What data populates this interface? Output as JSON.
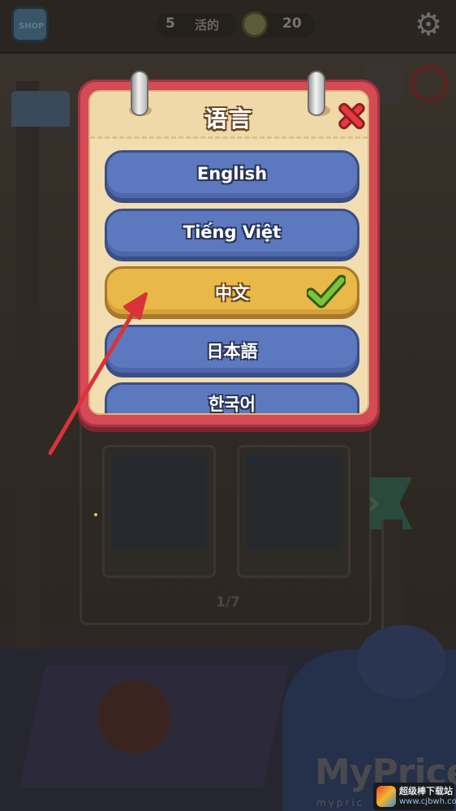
{
  "hud": {
    "level_number": "5",
    "level_text": "活的",
    "coins": "20"
  },
  "scene": {
    "page_indicator": "1/7"
  },
  "dialog": {
    "title": "语言",
    "languages": [
      {
        "label": "English",
        "selected": false
      },
      {
        "label": "Tiếng Việt",
        "selected": false
      },
      {
        "label": "中文",
        "selected": true
      },
      {
        "label": "日本語",
        "selected": false
      },
      {
        "label": "한국어",
        "selected": false
      }
    ]
  },
  "watermark": {
    "brand": "MyPrice",
    "sub": "mypric",
    "badge_line1": "超级棒下载站",
    "badge_line2": "www.cjbwh.com"
  },
  "colors": {
    "dialog_frame": "#d44a55",
    "paper": "#f2ddb0",
    "button_blue": "#5c79bf",
    "button_selected": "#e8b848",
    "checkmark": "#7cc33a",
    "annotation_arrow": "#d9333a"
  }
}
